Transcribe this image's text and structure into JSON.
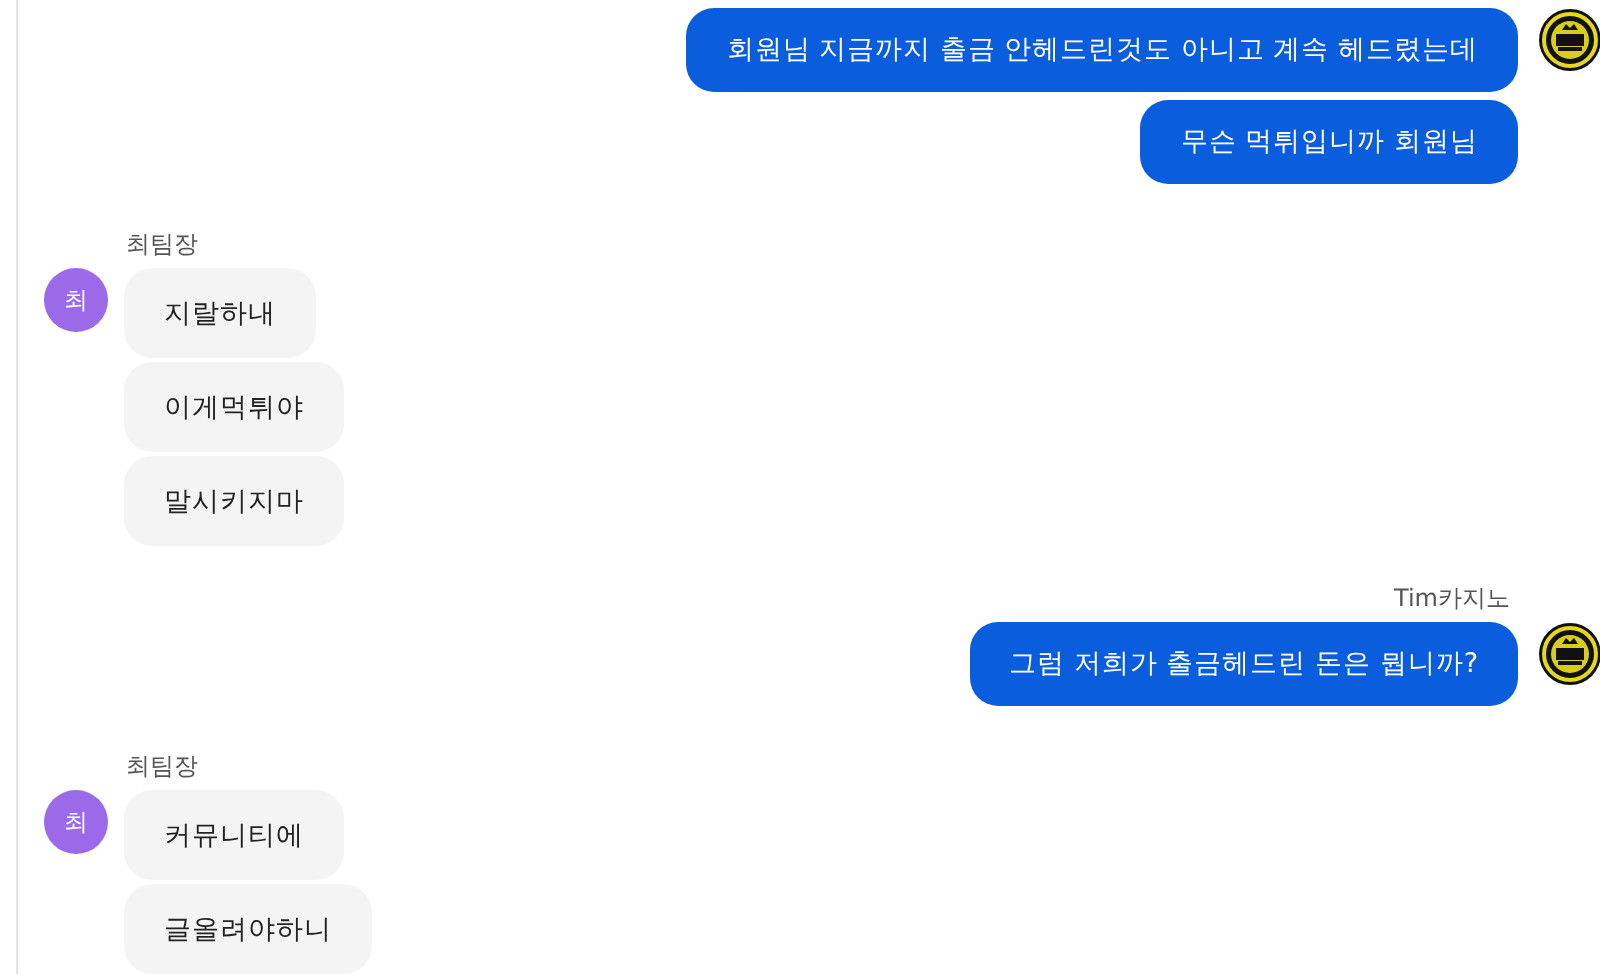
{
  "groups": [
    {
      "kind": "outgoing",
      "messages": [
        "회원님 지금까지 출금 안헤드린것도 아니고 계속 헤드렸는데",
        "무슨 먹튀입니까 회원님"
      ]
    },
    {
      "kind": "incoming",
      "sender": "최팀장",
      "initial": "최",
      "messages": [
        "지랄하내",
        "이게먹튀야",
        "말시키지마"
      ]
    },
    {
      "kind": "outgoing",
      "sender": "Tim카지노",
      "messages": [
        "그럼 저희가 출금헤드린 돈은 뭡니까?"
      ]
    },
    {
      "kind": "incoming",
      "sender": "최팀장",
      "initial": "최",
      "messages": [
        "커뮤니티에",
        "글올려야하니"
      ]
    }
  ]
}
